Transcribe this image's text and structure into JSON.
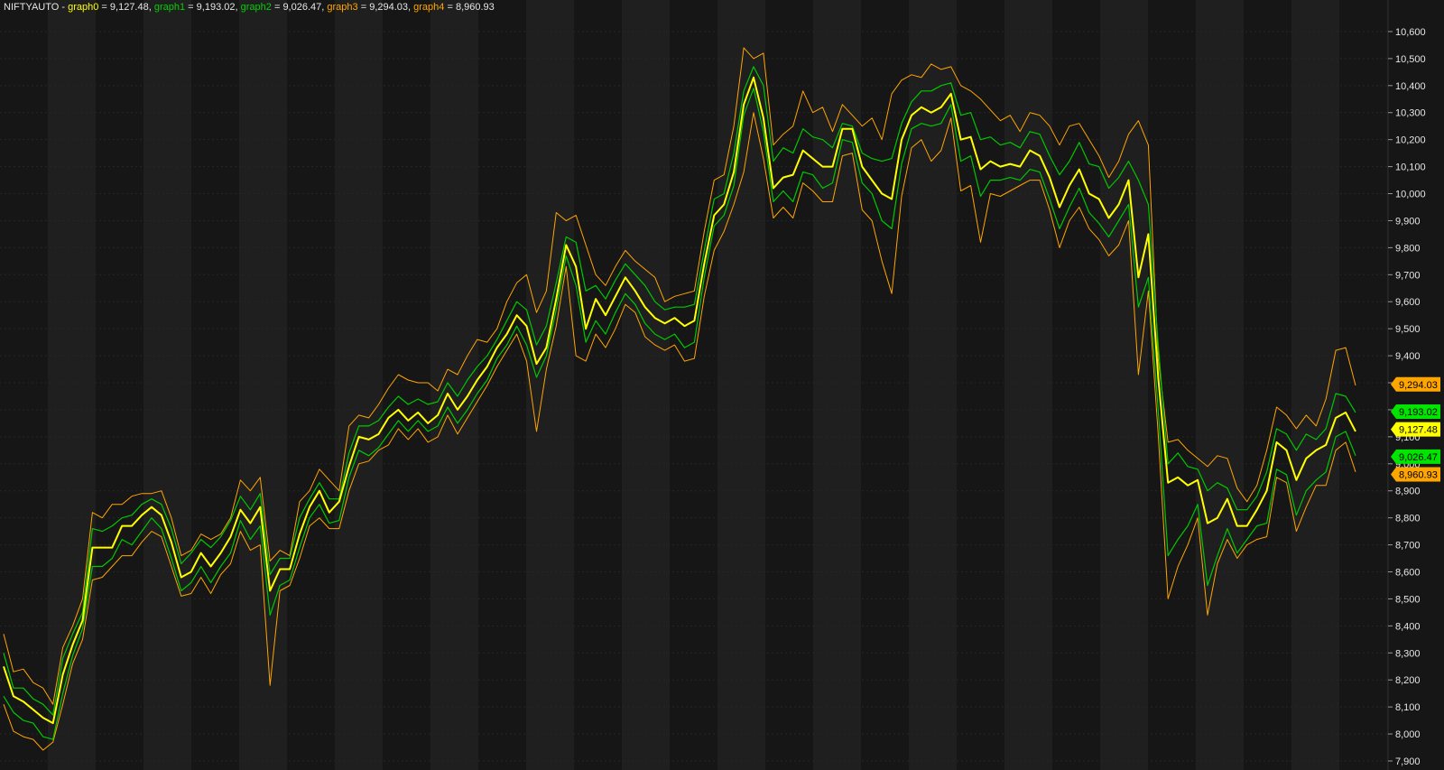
{
  "header": {
    "symbol_text": "NIFTYAUTO - ",
    "items": [
      {
        "name": "graph0",
        "value_text": "9,127.48",
        "sep": ", "
      },
      {
        "name": "graph1",
        "value_text": "9,193.02",
        "sep": ", "
      },
      {
        "name": "graph2",
        "value_text": "9,026.47",
        "sep": ", "
      },
      {
        "name": "graph3",
        "value_text": "9,294.03",
        "sep": ", "
      },
      {
        "name": "graph4",
        "value_text": "8,960.93",
        "sep": ""
      }
    ]
  },
  "colors": {
    "background": "#161616",
    "band_alt": "#1f1f1f",
    "graph0": "#ffff00",
    "graph1": "#00c800",
    "graph2": "#00c800",
    "graph3": "#ffa500",
    "graph4": "#ffa500",
    "tag_green": "#00e400",
    "tag_orange": "#ffa500",
    "tag_yellow": "#ffff00",
    "axis_text": "#e6e6e6"
  },
  "chart_data": {
    "type": "line",
    "title": "NIFTYAUTO",
    "y_axis_side": "right",
    "ylim": [
      7900,
      10650
    ],
    "yticks": [
      {
        "value": 7900,
        "label": "7,900"
      },
      {
        "value": 8000,
        "label": "8,000"
      },
      {
        "value": 8100,
        "label": "8,100"
      },
      {
        "value": 8200,
        "label": "8,200"
      },
      {
        "value": 8300,
        "label": "8,300"
      },
      {
        "value": 8400,
        "label": "8,400"
      },
      {
        "value": 8500,
        "label": "8,500"
      },
      {
        "value": 8600,
        "label": "8,600"
      },
      {
        "value": 8700,
        "label": "8,700"
      },
      {
        "value": 8800,
        "label": "8,800"
      },
      {
        "value": 8900,
        "label": "8,900"
      },
      {
        "value": 9000,
        "label": "9,000"
      },
      {
        "value": 9100,
        "label": "9,100"
      },
      {
        "value": 9200,
        "label": "9,200"
      },
      {
        "value": 9300,
        "label": "9,300"
      },
      {
        "value": 9400,
        "label": "9,400"
      },
      {
        "value": 9500,
        "label": "9,500"
      },
      {
        "value": 9600,
        "label": "9,600"
      },
      {
        "value": 9700,
        "label": "9,700"
      },
      {
        "value": 9800,
        "label": "9,800"
      },
      {
        "value": 9900,
        "label": "9,900"
      },
      {
        "value": 10000,
        "label": "10,000"
      },
      {
        "value": 10100,
        "label": "10,100"
      },
      {
        "value": 10200,
        "label": "10,200"
      },
      {
        "value": 10300,
        "label": "10,300"
      },
      {
        "value": 10400,
        "label": "10,400"
      },
      {
        "value": 10500,
        "label": "10,500"
      },
      {
        "value": 10600,
        "label": "10,600"
      }
    ],
    "grid": true,
    "series": [
      {
        "name": "graph0",
        "color": "#ffff00",
        "width": 2,
        "values": [
          8250,
          8140,
          8120,
          8090,
          8060,
          8040,
          8220,
          8330,
          8420,
          8690,
          8690,
          8690,
          8770,
          8770,
          8810,
          8840,
          8810,
          8710,
          8580,
          8600,
          8670,
          8620,
          8670,
          8730,
          8830,
          8780,
          8840,
          8530,
          8610,
          8610,
          8740,
          8840,
          8900,
          8820,
          8860,
          8990,
          9100,
          9090,
          9110,
          9170,
          9200,
          9160,
          9190,
          9150,
          9180,
          9260,
          9200,
          9250,
          9310,
          9360,
          9430,
          9480,
          9550,
          9510,
          9370,
          9430,
          9610,
          9810,
          9730,
          9500,
          9610,
          9550,
          9620,
          9690,
          9640,
          9580,
          9540,
          9520,
          9540,
          9510,
          9530,
          9740,
          9920,
          9960,
          10080,
          10330,
          10430,
          10280,
          10020,
          10060,
          10070,
          10160,
          10130,
          10100,
          10100,
          10240,
          10240,
          10100,
          10050,
          10000,
          9980,
          10200,
          10290,
          10320,
          10300,
          10320,
          10370,
          10200,
          10210,
          10090,
          10120,
          10100,
          10110,
          10100,
          10160,
          10140,
          10060,
          9950,
          10030,
          10090,
          10000,
          9980,
          9910,
          9960,
          10050,
          9690,
          9850,
          9320,
          8930,
          8950,
          8920,
          8940,
          8780,
          8800,
          8870,
          8770,
          8770,
          8830,
          8900,
          9080,
          9050,
          8940,
          9020,
          9050,
          9070,
          9170,
          9190,
          9120
        ]
      },
      {
        "name": "graph1",
        "color": "#00c800",
        "width": 1.2,
        "values": [
          8300,
          8170,
          8170,
          8130,
          8110,
          8070,
          8280,
          8370,
          8450,
          8760,
          8750,
          8770,
          8800,
          8810,
          8850,
          8870,
          8850,
          8760,
          8630,
          8670,
          8720,
          8690,
          8730,
          8790,
          8880,
          8830,
          8890,
          8590,
          8650,
          8650,
          8800,
          8870,
          8930,
          8870,
          8870,
          9040,
          9140,
          9140,
          9160,
          9210,
          9250,
          9220,
          9240,
          9220,
          9230,
          9300,
          9250,
          9310,
          9360,
          9400,
          9460,
          9530,
          9600,
          9570,
          9440,
          9510,
          9670,
          9840,
          9820,
          9640,
          9660,
          9610,
          9680,
          9740,
          9700,
          9660,
          9600,
          9570,
          9580,
          9580,
          9590,
          9790,
          9980,
          10000,
          10150,
          10380,
          10470,
          10400,
          10120,
          10170,
          10150,
          10240,
          10210,
          10200,
          10170,
          10260,
          10250,
          10150,
          10130,
          10120,
          10130,
          10260,
          10340,
          10380,
          10380,
          10400,
          10410,
          10290,
          10300,
          10200,
          10210,
          10180,
          10190,
          10170,
          10230,
          10220,
          10140,
          10070,
          10120,
          10190,
          10110,
          10100,
          10020,
          10060,
          10120,
          10050,
          9960,
          9440,
          9000,
          9040,
          8990,
          8980,
          8900,
          8930,
          8910,
          8830,
          8830,
          8880,
          8970,
          9130,
          9110,
          9050,
          9110,
          9090,
          9130,
          9260,
          9250,
          9190
        ]
      },
      {
        "name": "graph2",
        "color": "#00c800",
        "width": 1.2,
        "values": [
          8140,
          8080,
          8050,
          8040,
          7990,
          7980,
          8150,
          8290,
          8390,
          8620,
          8620,
          8650,
          8720,
          8700,
          8750,
          8800,
          8760,
          8650,
          8530,
          8560,
          8620,
          8560,
          8620,
          8670,
          8790,
          8720,
          8770,
          8440,
          8550,
          8570,
          8690,
          8800,
          8850,
          8780,
          8790,
          8950,
          9050,
          9030,
          9060,
          9110,
          9160,
          9120,
          9160,
          9120,
          9140,
          9210,
          9150,
          9200,
          9260,
          9310,
          9390,
          9440,
          9510,
          9440,
          9320,
          9400,
          9570,
          9770,
          9660,
          9450,
          9530,
          9480,
          9560,
          9630,
          9590,
          9520,
          9480,
          9460,
          9480,
          9430,
          9450,
          9690,
          9880,
          9920,
          10030,
          10290,
          10390,
          10230,
          9970,
          10010,
          9970,
          10080,
          10070,
          10020,
          10040,
          10200,
          10190,
          10040,
          10000,
          9900,
          9870,
          10110,
          10240,
          10260,
          10250,
          10260,
          10330,
          10120,
          10140,
          9990,
          10050,
          10050,
          10060,
          10050,
          10090,
          10080,
          9980,
          9870,
          9950,
          10020,
          9930,
          9890,
          9840,
          9900,
          9960,
          9580,
          9690,
          9200,
          8660,
          8720,
          8770,
          8850,
          8550,
          8660,
          8760,
          8670,
          8720,
          8770,
          8780,
          8980,
          8960,
          8810,
          8900,
          8940,
          8970,
          9100,
          9120,
          9030
        ]
      },
      {
        "name": "graph3",
        "color": "#ffa500",
        "width": 1,
        "values": [
          8370,
          8230,
          8240,
          8190,
          8170,
          8110,
          8320,
          8400,
          8500,
          8820,
          8800,
          8850,
          8850,
          8880,
          8890,
          8890,
          8900,
          8800,
          8660,
          8680,
          8740,
          8720,
          8740,
          8800,
          8940,
          8900,
          8950,
          8640,
          8680,
          8660,
          8860,
          8900,
          8980,
          8940,
          8900,
          9140,
          9180,
          9170,
          9220,
          9280,
          9330,
          9310,
          9300,
          9300,
          9270,
          9350,
          9330,
          9400,
          9460,
          9450,
          9500,
          9600,
          9670,
          9700,
          9560,
          9640,
          9930,
          9900,
          9920,
          9810,
          9700,
          9660,
          9730,
          9790,
          9750,
          9720,
          9690,
          9600,
          9620,
          9630,
          9640,
          9860,
          10050,
          10070,
          10250,
          10540,
          10500,
          10520,
          10180,
          10220,
          10250,
          10380,
          10300,
          10320,
          10230,
          10330,
          10290,
          10250,
          10280,
          10200,
          10370,
          10420,
          10440,
          10430,
          10480,
          10460,
          10470,
          10400,
          10380,
          10350,
          10310,
          10270,
          10290,
          10230,
          10300,
          10290,
          10250,
          10180,
          10250,
          10260,
          10200,
          10140,
          10060,
          10120,
          10220,
          10270,
          10180,
          9390,
          9080,
          9090,
          9050,
          9020,
          8990,
          9030,
          9020,
          8910,
          8860,
          8920,
          9050,
          9210,
          9180,
          9130,
          9180,
          9140,
          9240,
          9420,
          9430,
          9290
        ]
      },
      {
        "name": "graph4",
        "color": "#ffa500",
        "width": 1,
        "values": [
          8110,
          8010,
          7990,
          7980,
          7940,
          7970,
          8110,
          8260,
          8350,
          8570,
          8580,
          8620,
          8660,
          8660,
          8710,
          8750,
          8730,
          8620,
          8510,
          8520,
          8580,
          8520,
          8590,
          8630,
          8750,
          8680,
          8700,
          8180,
          8530,
          8550,
          8650,
          8770,
          8800,
          8760,
          8760,
          8900,
          9000,
          9010,
          9050,
          9070,
          9130,
          9090,
          9130,
          9080,
          9100,
          9180,
          9110,
          9170,
          9230,
          9290,
          9360,
          9420,
          9480,
          9380,
          9120,
          9350,
          9510,
          9730,
          9400,
          9380,
          9480,
          9430,
          9500,
          9590,
          9560,
          9470,
          9440,
          9420,
          9440,
          9380,
          9390,
          9620,
          9790,
          9860,
          9960,
          10080,
          10300,
          10130,
          9910,
          9950,
          9910,
          10040,
          10010,
          9970,
          9970,
          10140,
          10150,
          9940,
          9900,
          9750,
          9630,
          9990,
          10170,
          10200,
          10120,
          10160,
          10280,
          10010,
          10030,
          9820,
          10000,
          9990,
          10010,
          10030,
          10050,
          10050,
          9940,
          9800,
          9900,
          9950,
          9870,
          9830,
          9770,
          9810,
          9900,
          9330,
          9640,
          9110,
          8500,
          8620,
          8700,
          8800,
          8440,
          8630,
          8720,
          8650,
          8700,
          8720,
          8730,
          8950,
          8930,
          8750,
          8840,
          8920,
          8920,
          9050,
          9080,
          8970
        ]
      }
    ],
    "last_value_tags": [
      {
        "series": "graph3",
        "label": "9,294.03",
        "value": 9294.03,
        "color": "#ffa500"
      },
      {
        "series": "graph1",
        "label": "9,193.02",
        "value": 9193.02,
        "color": "#00e400"
      },
      {
        "series": "graph0",
        "label": "9,127.48",
        "value": 9127.48,
        "color": "#ffff00"
      },
      {
        "series": "graph2",
        "label": "9,026.47",
        "value": 9026.47,
        "color": "#00e400"
      },
      {
        "series": "graph4",
        "label": "8,960.93",
        "value": 8960.93,
        "color": "#ffa500"
      }
    ]
  }
}
